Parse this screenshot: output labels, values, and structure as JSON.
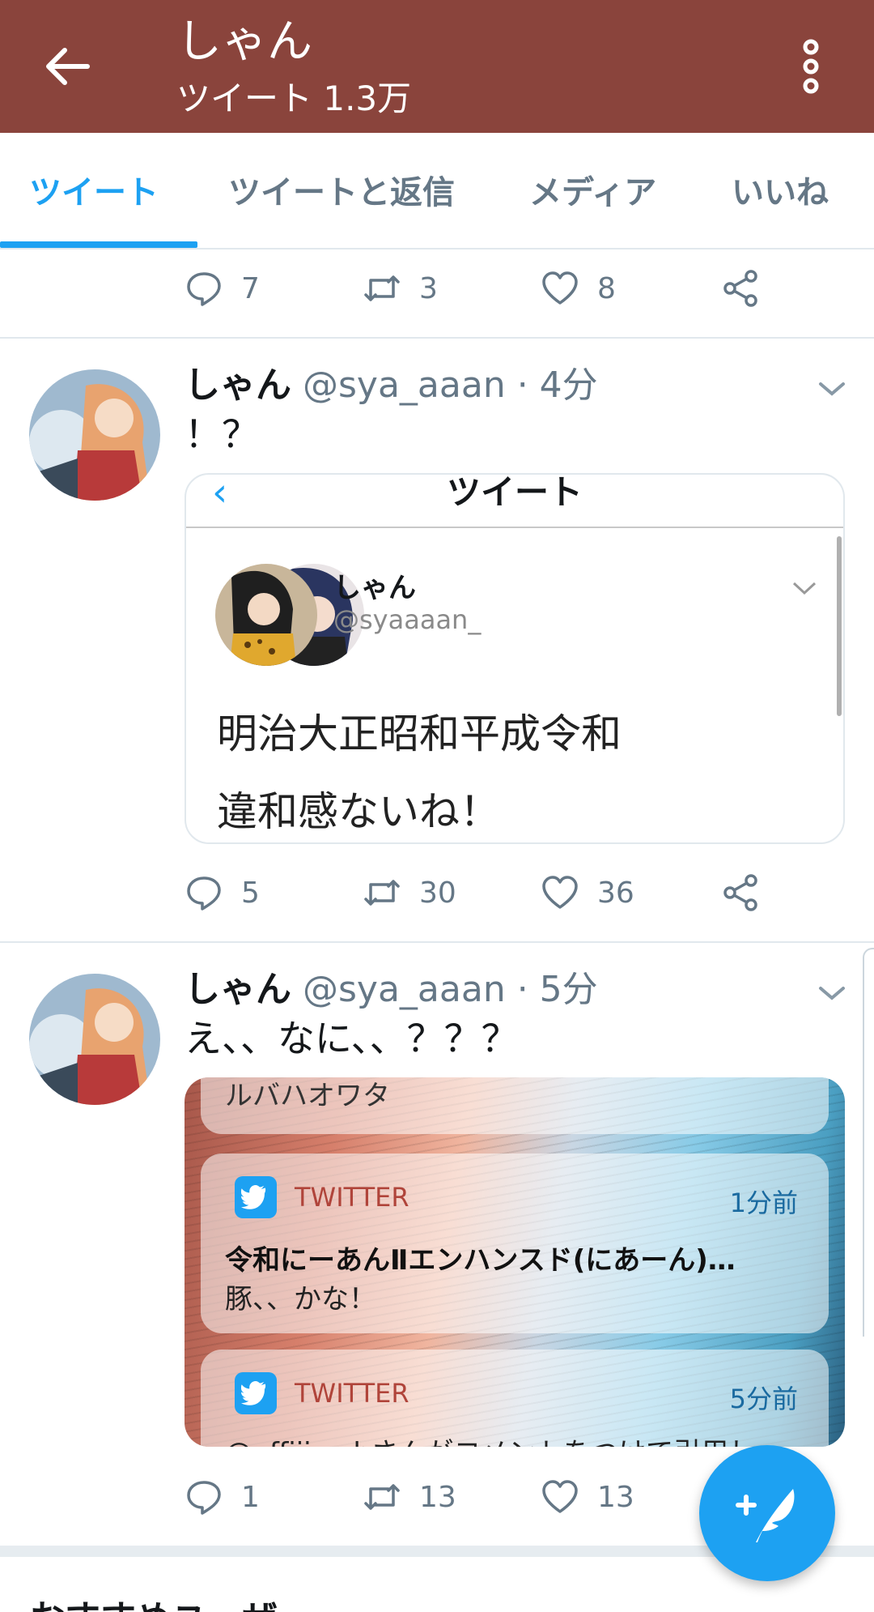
{
  "header": {
    "title": "しゃん",
    "subtitle": "ツイート 1.3万",
    "icons": {
      "back": "arrow-left-icon",
      "more": "more-vertical-icon"
    },
    "color": "#8a443c"
  },
  "tabs": [
    {
      "label": "ツイート",
      "active": true
    },
    {
      "label": "ツイートと返信",
      "active": false
    },
    {
      "label": "メディア",
      "active": false
    },
    {
      "label": "いいね",
      "active": false
    }
  ],
  "accent": "#1da1f2",
  "top_actions": {
    "reply": "7",
    "retweet": "3",
    "like": "8"
  },
  "tweets": [
    {
      "name": "しゃん",
      "handle": "@sya_aaan",
      "time": "· 4分",
      "text": "！？",
      "embed": {
        "nav_back": "‹",
        "nav_title": "ツイート",
        "name": "しゃん",
        "handle": "@syaaaan_",
        "line1": "明治大正昭和平成令和",
        "line2": "違和感ないね！"
      },
      "actions": {
        "reply": "5",
        "retweet": "30",
        "like": "36"
      }
    },
    {
      "name": "しゃん",
      "handle": "@sya_aaan",
      "time": "· 5分",
      "text": "え、、なに、、？？？",
      "embed": {
        "peek_text": "ルバハオワタ",
        "notifications": [
          {
            "app": "TWITTER",
            "when": "1分前",
            "title": "令和にーあんⅡエンハンスド(にあーん)…",
            "body": "豚、、かな！"
          },
          {
            "app": "TWITTER",
            "when": "5分前",
            "title": "",
            "body": "@affiii_nrhさんがコメントをつけて引用し"
          }
        ]
      },
      "actions": {
        "reply": "1",
        "retweet": "13",
        "like": "13"
      }
    }
  ],
  "footer": {
    "section_title": "おすすめユーザー"
  }
}
